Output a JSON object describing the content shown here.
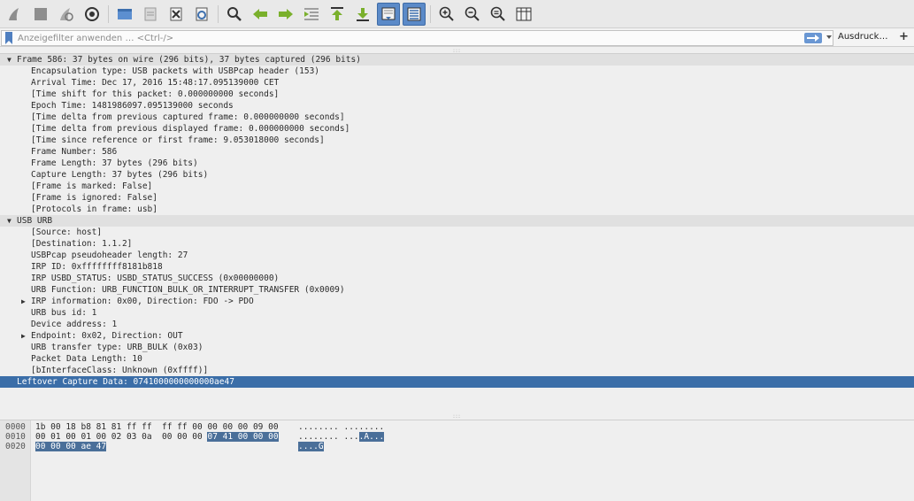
{
  "toolbar": {
    "buttons": [
      {
        "icon": "shark-fin-start-icon"
      },
      {
        "icon": "stop-icon"
      },
      {
        "icon": "restart-icon"
      },
      {
        "icon": "capture-options-icon"
      },
      {
        "icon": "open-file-icon"
      },
      {
        "icon": "save-file-icon"
      },
      {
        "icon": "close-file-icon"
      },
      {
        "icon": "reload-icon"
      },
      {
        "icon": "find-icon"
      },
      {
        "icon": "go-back-icon"
      },
      {
        "icon": "go-forward-icon"
      },
      {
        "icon": "go-to-packet-icon"
      },
      {
        "icon": "go-first-icon"
      },
      {
        "icon": "go-last-icon"
      },
      {
        "icon": "autoscroll-icon"
      },
      {
        "icon": "colorize-icon"
      },
      {
        "icon": "zoom-in-icon"
      },
      {
        "icon": "zoom-out-icon"
      },
      {
        "icon": "zoom-normal-icon"
      },
      {
        "icon": "resize-columns-icon"
      }
    ]
  },
  "filter": {
    "placeholder": "Anzeigefilter anwenden … <Ctrl-/>",
    "expression_label": "Ausdruck…",
    "plus_label": "+"
  },
  "details": {
    "rows": [
      {
        "level": 0,
        "arrow": "▼",
        "text": "Frame 586: 37 bytes on wire (296 bits), 37 bytes captured (296 bits)",
        "header": true
      },
      {
        "level": 1,
        "arrow": "",
        "text": "Encapsulation type: USB packets with USBPcap header (153)"
      },
      {
        "level": 1,
        "arrow": "",
        "text": "Arrival Time: Dec 17, 2016 15:48:17.095139000 CET"
      },
      {
        "level": 1,
        "arrow": "",
        "text": "[Time shift for this packet: 0.000000000 seconds]"
      },
      {
        "level": 1,
        "arrow": "",
        "text": "Epoch Time: 1481986097.095139000 seconds"
      },
      {
        "level": 1,
        "arrow": "",
        "text": "[Time delta from previous captured frame: 0.000000000 seconds]"
      },
      {
        "level": 1,
        "arrow": "",
        "text": "[Time delta from previous displayed frame: 0.000000000 seconds]"
      },
      {
        "level": 1,
        "arrow": "",
        "text": "[Time since reference or first frame: 9.053018000 seconds]"
      },
      {
        "level": 1,
        "arrow": "",
        "text": "Frame Number: 586"
      },
      {
        "level": 1,
        "arrow": "",
        "text": "Frame Length: 37 bytes (296 bits)"
      },
      {
        "level": 1,
        "arrow": "",
        "text": "Capture Length: 37 bytes (296 bits)"
      },
      {
        "level": 1,
        "arrow": "",
        "text": "[Frame is marked: False]"
      },
      {
        "level": 1,
        "arrow": "",
        "text": "[Frame is ignored: False]"
      },
      {
        "level": 1,
        "arrow": "",
        "text": "[Protocols in frame: usb]"
      },
      {
        "level": 0,
        "arrow": "▼",
        "text": "USB URB",
        "header": true
      },
      {
        "level": 1,
        "arrow": "",
        "text": "[Source: host]"
      },
      {
        "level": 1,
        "arrow": "",
        "text": "[Destination: 1.1.2]"
      },
      {
        "level": 1,
        "arrow": "",
        "text": "USBPcap pseudoheader length: 27"
      },
      {
        "level": 1,
        "arrow": "",
        "text": "IRP ID: 0xffffffff8181b818"
      },
      {
        "level": 1,
        "arrow": "",
        "text": "IRP USBD_STATUS: USBD_STATUS_SUCCESS (0x00000000)"
      },
      {
        "level": 1,
        "arrow": "",
        "text": "URB Function: URB_FUNCTION_BULK_OR_INTERRUPT_TRANSFER (0x0009)"
      },
      {
        "level": 1,
        "arrow": "▶",
        "text": "IRP information: 0x00, Direction: FDO -> PDO"
      },
      {
        "level": 1,
        "arrow": "",
        "text": "URB bus id: 1"
      },
      {
        "level": 1,
        "arrow": "",
        "text": "Device address: 1"
      },
      {
        "level": 1,
        "arrow": "▶",
        "text": "Endpoint: 0x02, Direction: OUT"
      },
      {
        "level": 1,
        "arrow": "",
        "text": "URB transfer type: URB_BULK (0x03)"
      },
      {
        "level": 1,
        "arrow": "",
        "text": "Packet Data Length: 10"
      },
      {
        "level": 1,
        "arrow": "",
        "text": "[bInterfaceClass: Unknown (0xffff)]"
      },
      {
        "level": 0,
        "arrow": "",
        "text": "Leftover Capture Data: 0741000000000000ae47",
        "selected": true
      }
    ]
  },
  "bytes": {
    "rows": [
      {
        "offset": "0000",
        "hex": "1b 00 18 b8 81 81 ff ff  ff ff 00 00 00 00 09 00",
        "hex_hl": "",
        "ascii": "........ ........",
        "ascii_hl": ""
      },
      {
        "offset": "0010",
        "hex": "00 01 00 01 00 02 03 0a  00 00 00 ",
        "hex_hl": "07 41 00 00 00",
        "ascii": "........ ...",
        "ascii_hl": ".A..."
      },
      {
        "offset": "0020",
        "hex": "",
        "hex_hl": "00 00 00 ae 47",
        "ascii": "",
        "ascii_hl": "....G"
      }
    ]
  }
}
